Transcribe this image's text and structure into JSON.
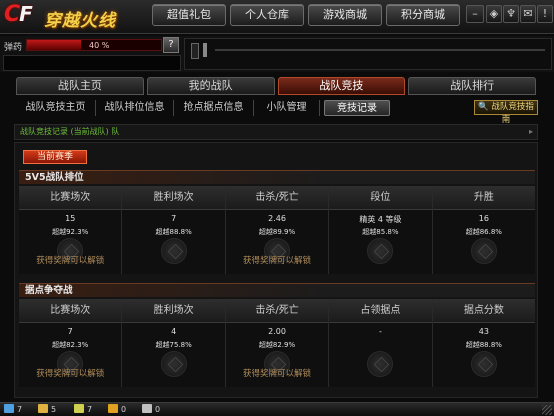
{
  "app": {
    "logo_prefix": "C",
    "logo_suffix": "F",
    "logo_text": "穿越火线"
  },
  "topnav": [
    {
      "label": "超值礼包"
    },
    {
      "label": "个人仓库"
    },
    {
      "label": "游戏商城"
    },
    {
      "label": "积分商城"
    }
  ],
  "top_icons": [
    {
      "name": "minimize-icon",
      "glyph": "–"
    },
    {
      "name": "shield-icon",
      "glyph": "◈"
    },
    {
      "name": "trophy-icon",
      "glyph": "♆"
    },
    {
      "name": "mail-icon",
      "glyph": "✉"
    },
    {
      "name": "alert-icon",
      "glyph": "!"
    },
    {
      "name": "settings-icon",
      "glyph": "☰"
    },
    {
      "name": "close-icon",
      "glyph": "✕"
    }
  ],
  "status": {
    "ammo_label": "弹药",
    "hp_text": "40 %",
    "hp_fraction": 0.4,
    "help_label": "?"
  },
  "main_tabs": [
    {
      "label": "战队主页",
      "active": false
    },
    {
      "label": "我的战队",
      "active": false
    },
    {
      "label": "战队竞技",
      "active": true
    },
    {
      "label": "战队排行",
      "active": false
    }
  ],
  "sub_tabs": [
    {
      "label": "战队竞技主页",
      "active": false
    },
    {
      "label": "战队排位信息",
      "active": false
    },
    {
      "label": "抢点据点信息",
      "active": false
    },
    {
      "label": "小队管理",
      "active": false
    },
    {
      "label": "竞技记录",
      "active": true
    }
  ],
  "guide_button": "战队竞技指南",
  "path_text": "战队竞技记录 (当前战队) 队",
  "current_season_button": "当前赛季",
  "section_5v5": {
    "title": "5V5战队排位",
    "columns": [
      "比赛场次",
      "胜利场次",
      "击杀/死亡",
      "段位",
      "升胜"
    ],
    "values": [
      "15",
      "7",
      "2.46",
      "精英 4 等级",
      "16"
    ],
    "ranks": [
      "超越92.3%",
      "超越88.8%",
      "超越89.9%",
      "超越85.8%",
      "超越86.8%"
    ],
    "notes": [
      "获得奖牌可以解锁",
      "",
      "获得奖牌可以解锁",
      "",
      ""
    ]
  },
  "section_stronghold": {
    "title": "据点争夺战",
    "columns": [
      "比赛场次",
      "胜利场次",
      "击杀/死亡",
      "占领据点",
      "据点分数"
    ],
    "values": [
      "7",
      "4",
      "2.00",
      "-",
      "43"
    ],
    "ranks": [
      "超越82.3%",
      "超越75.8%",
      "超越82.9%",
      "",
      "超越88.8%"
    ],
    "notes": [
      "获得奖牌可以解锁",
      "",
      "获得奖牌可以解锁",
      "",
      ""
    ]
  },
  "bottombar": [
    {
      "value": "7"
    },
    {
      "value": "5"
    },
    {
      "value": "7"
    },
    {
      "value": "0"
    },
    {
      "value": "0"
    }
  ]
}
